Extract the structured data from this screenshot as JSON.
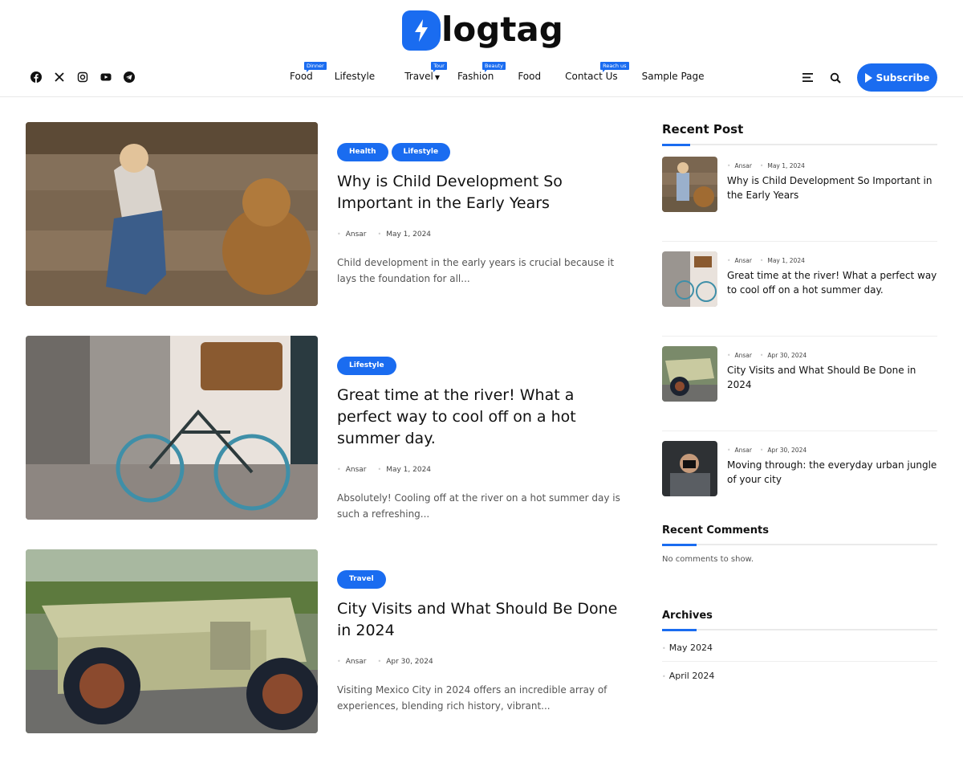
{
  "brand": {
    "logo_letter_icon": "lightning-bolt-icon",
    "logo_text": "logtag",
    "accent": "#1a6cf0"
  },
  "social": [
    {
      "name": "facebook-icon"
    },
    {
      "name": "x-twitter-icon"
    },
    {
      "name": "instagram-icon"
    },
    {
      "name": "youtube-icon"
    },
    {
      "name": "telegram-icon"
    }
  ],
  "nav": [
    {
      "label": "Food",
      "badge": "Dinner"
    },
    {
      "label": "Lifestyle",
      "badge": null
    },
    {
      "label": "Travel",
      "badge": "Tour",
      "has_dropdown": true
    },
    {
      "label": "Fashion",
      "badge": "Beauty"
    },
    {
      "label": "Food",
      "badge": null
    },
    {
      "label": "Contact Us",
      "badge": "Reach us"
    },
    {
      "label": "Sample Page",
      "badge": null
    }
  ],
  "header_actions": {
    "subscribe_label": "Subscribe"
  },
  "posts": [
    {
      "tags": [
        "Health",
        "Lifestyle"
      ],
      "title": "Why is Child Development So Important in the Early Years",
      "author": "Ansar",
      "date": "May 1, 2024",
      "excerpt": "Child development in the early years is crucial because it lays the foundation for all..."
    },
    {
      "tags": [
        "Lifestyle"
      ],
      "title": "Great time at the river! What a perfect way to cool off on a hot summer day.",
      "author": "Ansar",
      "date": "May 1, 2024",
      "excerpt": "Absolutely! Cooling off at the river on a hot summer day is such a refreshing..."
    },
    {
      "tags": [
        "Travel"
      ],
      "title": "City Visits and What Should Be Done in 2024",
      "author": "Ansar",
      "date": "Apr 30, 2024",
      "excerpt": "Visiting Mexico City in 2024 offers an incredible array of experiences, blending rich history, vibrant..."
    }
  ],
  "sidebar": {
    "recent_post_title": "Recent Post",
    "recent_posts": [
      {
        "author": "Ansar",
        "date": "May 1, 2024",
        "title": "Why is Child Development So Important in the Early Years"
      },
      {
        "author": "Ansar",
        "date": "May 1, 2024",
        "title": "Great time at the river! What a perfect way to cool off on a hot summer day."
      },
      {
        "author": "Ansar",
        "date": "Apr 30, 2024",
        "title": "City Visits and What Should Be Done in 2024"
      },
      {
        "author": "Ansar",
        "date": "Apr 30, 2024",
        "title": "Moving through: the everyday urban jungle of your city"
      }
    ],
    "recent_comments_title": "Recent Comments",
    "no_comments": "No comments to show.",
    "archives_title": "Archives",
    "archives": [
      "May 2024",
      "April 2024"
    ]
  }
}
